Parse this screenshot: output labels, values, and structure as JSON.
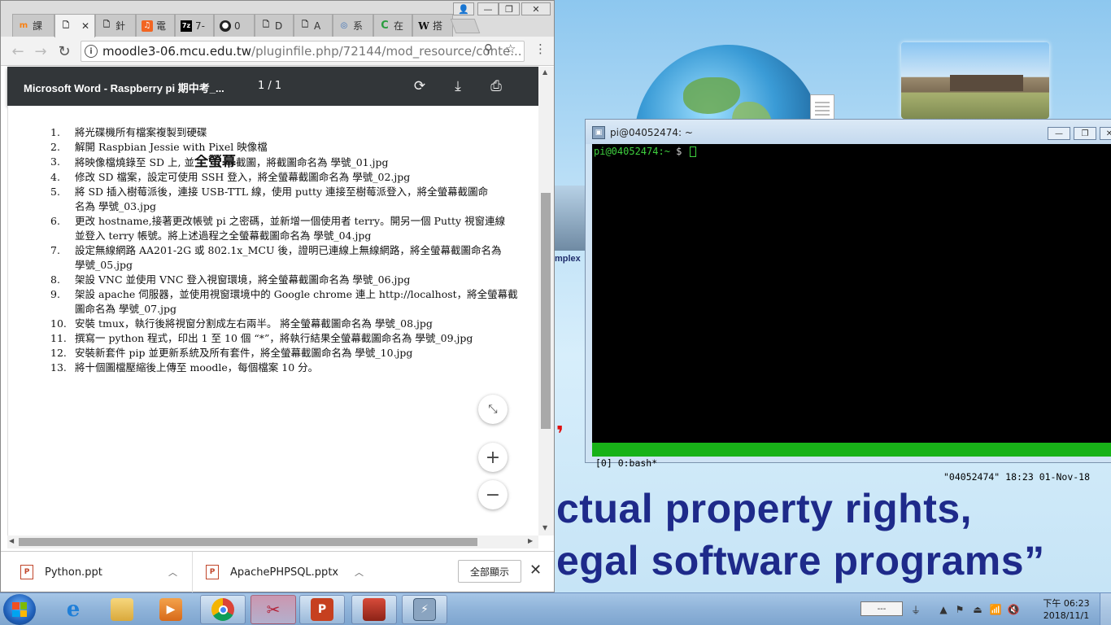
{
  "chrome": {
    "tabs": [
      {
        "label": "課",
        "icon": "moodle-icon"
      },
      {
        "label": "",
        "icon": "document-icon",
        "active": true
      },
      {
        "label": "針",
        "icon": "document-icon"
      },
      {
        "label": "電",
        "icon": "orange-icon"
      },
      {
        "label": "7-",
        "icon": "7zip-icon"
      },
      {
        "label": "0",
        "icon": "github-icon"
      },
      {
        "label": "D",
        "icon": "document-icon"
      },
      {
        "label": "A",
        "icon": "document-icon"
      },
      {
        "label": "系",
        "icon": "globe-icon"
      },
      {
        "label": "在",
        "icon": "green-c-icon"
      },
      {
        "label": "搭",
        "icon": "wikipedia-icon"
      }
    ],
    "url_host": "moodle3-06.mcu.edu.tw",
    "url_path": "/pluginfile.php/72144/mod_resource/conte...",
    "pdf": {
      "title": "Microsoft Word - Raspberry pi 期中考_...",
      "pages": "1  /  1",
      "items": [
        {
          "num": "1.",
          "text": "將光碟機所有檔案複製到硬碟"
        },
        {
          "num": "2.",
          "text": "解開 Raspbian Jessie with Pixel 映像檔"
        },
        {
          "num": "3.",
          "text_before": "將映像檔燒錄至 SD 上, 並",
          "bold": "全螢幕",
          "text_after": "截圖，將截圖命名為 學號_01.jpg"
        },
        {
          "num": "4.",
          "text": "修改 SD 檔案，設定可使用 SSH 登入，將全螢幕截圖命名為 學號_02.jpg"
        },
        {
          "num": "5.",
          "text": "將 SD 插入樹莓派後，連接 USB-TTL 線，使用 putty 連接至樹莓派登入，將全螢幕截圖命",
          "cont": "名為 學號_03.jpg"
        },
        {
          "num": "6.",
          "text": "更改 hostname,接著更改帳號 pi 之密碼，並新增一個使用者 terry。開另一個 Putty 視窗連線",
          "cont": "並登入 terry 帳號。將上述過程之全螢幕截圖命名為 學號_04.jpg"
        },
        {
          "num": "7.",
          "text": "設定無線網路 AA201-2G 或 802.1x_MCU 後，證明已連線上無線網路，將全螢幕截圖命名為",
          "cont": "學號_05.jpg"
        },
        {
          "num": "8.",
          "text": "架設 VNC 並使用 VNC 登入視窗環境，將全螢幕截圖命名為 學號_06.jpg"
        },
        {
          "num": "9.",
          "text": "架設 apache 伺服器，並使用視窗環境中的 Google chrome 連上 http://localhost，將全螢幕截",
          "cont": "圖命名為 學號_07.jpg"
        },
        {
          "num": "10.",
          "text": "安裝 tmux，執行後將視窗分割成左右兩半。 將全螢幕截圖命名為 學號_08.jpg"
        },
        {
          "num": "11.",
          "text": "撰寫一 python 程式，印出 1 至 10 個 “*”，將執行結果全螢幕截圖命名為 學號_09.jpg"
        },
        {
          "num": "12.",
          "text": "安裝新套件 pip 並更新系統及所有套件，將全螢幕截圖命名為 學號_10.jpg"
        },
        {
          "num": "13.",
          "text": "將十個圖檔壓縮後上傳至 moodle，每個檔案 10 分。"
        }
      ]
    },
    "downloads": [
      {
        "name": "Python.ppt"
      },
      {
        "name": "ApachePHPSQL.pptx"
      }
    ],
    "show_all": "全部顯示"
  },
  "terminal": {
    "title": "pi@04052474: ~",
    "prompt_user": "pi@04052474:~ ",
    "prompt_symbol": "$ ",
    "tmux_left": "[0] 0:bash*",
    "tmux_right": "\"04052474\" 18:23 01-Nov-18"
  },
  "desktop": {
    "side_text": "mplex",
    "slogan_line1": "ctual property rights,",
    "slogan_line2": "egal software programs”"
  },
  "taskbar": {
    "language": "---",
    "clock_time": "下午 06:23",
    "clock_date": "2018/11/1"
  }
}
